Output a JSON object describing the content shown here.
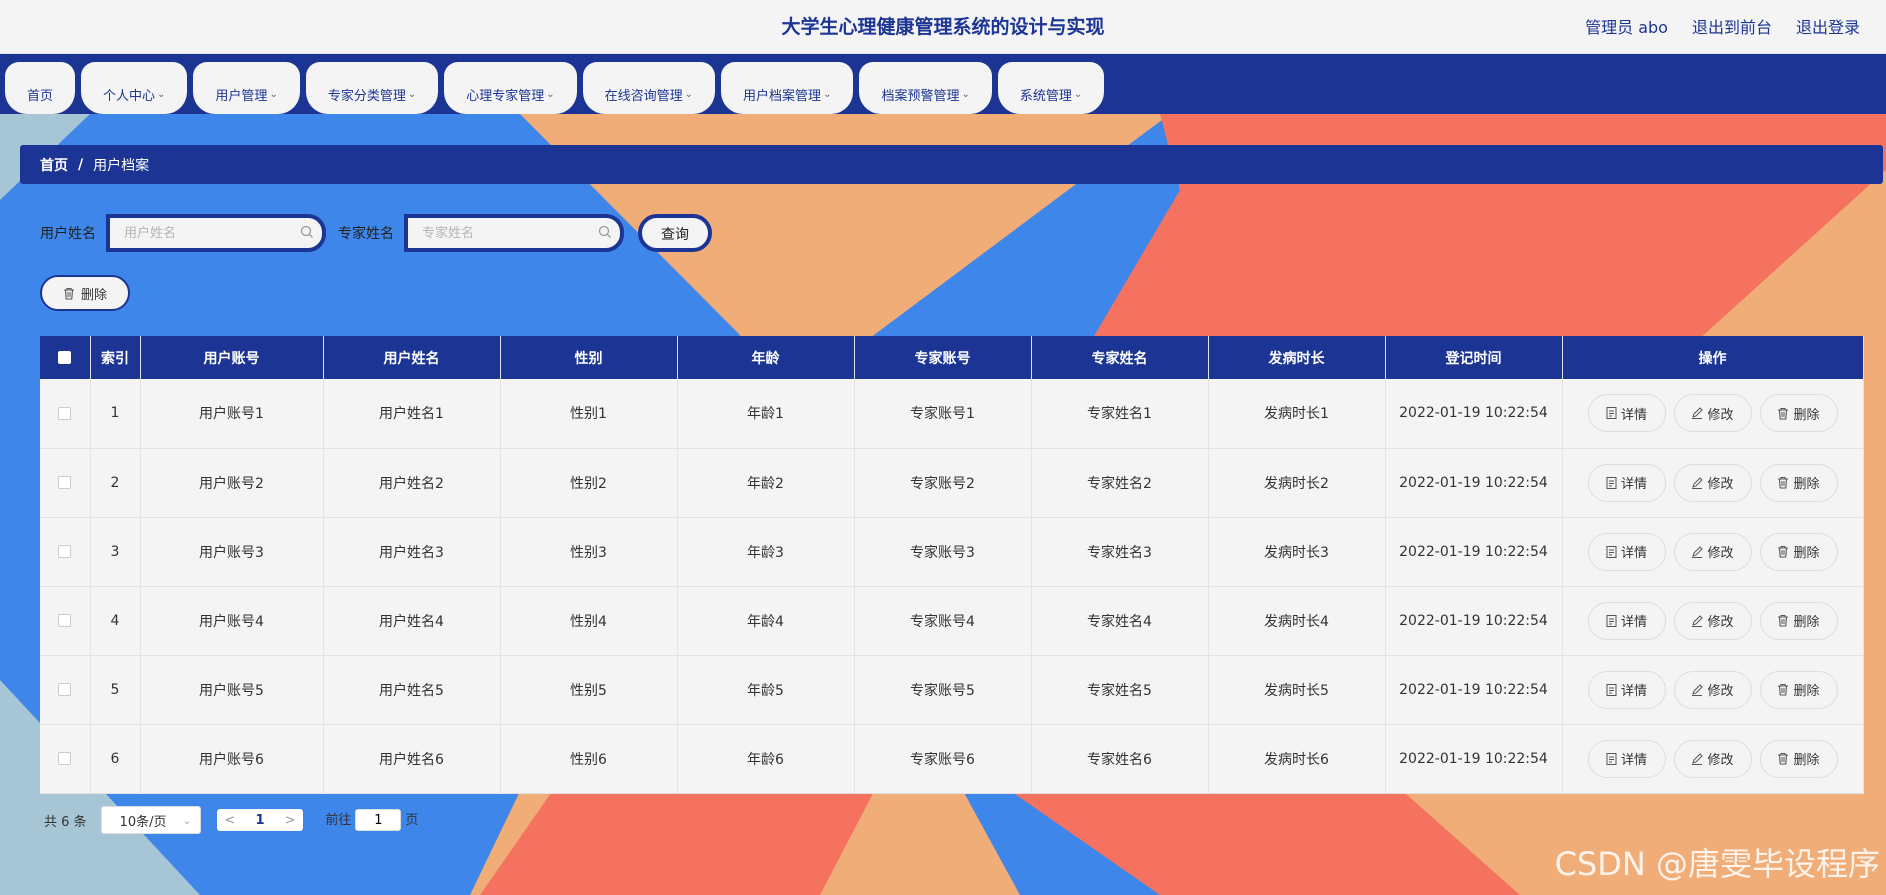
{
  "colors": {
    "primary": "#1c3594",
    "blue": "#3f86ea",
    "salmon": "#f4725f",
    "peach": "#f0ad78",
    "grey_blue": "#a6c6d6"
  },
  "header": {
    "title": "大学生心理健康管理系统的设计与实现",
    "admin": "管理员 abo",
    "to_front": "退出到前台",
    "logout": "退出登录"
  },
  "nav": {
    "items": [
      {
        "label": "首页"
      },
      {
        "label": "个人中心"
      },
      {
        "label": "用户管理"
      },
      {
        "label": "专家分类管理"
      },
      {
        "label": "心理专家管理"
      },
      {
        "label": "在线咨询管理"
      },
      {
        "label": "用户档案管理"
      },
      {
        "label": "档案预警管理"
      },
      {
        "label": "系统管理"
      }
    ]
  },
  "breadcrumb": {
    "home": "首页",
    "sep": "/",
    "current": "用户档案"
  },
  "search": {
    "user_label": "用户姓名",
    "user_placeholder": "用户姓名",
    "expert_label": "专家姓名",
    "expert_placeholder": "专家姓名",
    "query": "查询"
  },
  "toolbar": {
    "delete": "删除"
  },
  "table": {
    "headers": [
      "索引",
      "用户账号",
      "用户姓名",
      "性别",
      "年龄",
      "专家账号",
      "专家姓名",
      "发病时长",
      "登记时间",
      "操作"
    ],
    "rows": [
      {
        "index": "1",
        "account": "用户账号1",
        "name": "用户姓名1",
        "gender": "性别1",
        "age": "年龄1",
        "expert_account": "专家账号1",
        "expert_name": "专家姓名1",
        "duration": "发病时长1",
        "time": "2022-01-19 10:22:54"
      },
      {
        "index": "2",
        "account": "用户账号2",
        "name": "用户姓名2",
        "gender": "性别2",
        "age": "年龄2",
        "expert_account": "专家账号2",
        "expert_name": "专家姓名2",
        "duration": "发病时长2",
        "time": "2022-01-19 10:22:54"
      },
      {
        "index": "3",
        "account": "用户账号3",
        "name": "用户姓名3",
        "gender": "性别3",
        "age": "年龄3",
        "expert_account": "专家账号3",
        "expert_name": "专家姓名3",
        "duration": "发病时长3",
        "time": "2022-01-19 10:22:54"
      },
      {
        "index": "4",
        "account": "用户账号4",
        "name": "用户姓名4",
        "gender": "性别4",
        "age": "年龄4",
        "expert_account": "专家账号4",
        "expert_name": "专家姓名4",
        "duration": "发病时长4",
        "time": "2022-01-19 10:22:54"
      },
      {
        "index": "5",
        "account": "用户账号5",
        "name": "用户姓名5",
        "gender": "性别5",
        "age": "年龄5",
        "expert_account": "专家账号5",
        "expert_name": "专家姓名5",
        "duration": "发病时长5",
        "time": "2022-01-19 10:22:54"
      },
      {
        "index": "6",
        "account": "用户账号6",
        "name": "用户姓名6",
        "gender": "性别6",
        "age": "年龄6",
        "expert_account": "专家账号6",
        "expert_name": "专家姓名6",
        "duration": "发病时长6",
        "time": "2022-01-19 10:22:54"
      }
    ],
    "actions": {
      "detail": "详情",
      "edit": "修改",
      "delete": "删除"
    }
  },
  "pager": {
    "total": "共 6 条",
    "page_size": "10条/页",
    "current_page": "1",
    "goto_prefix": "前往",
    "goto_value": "1",
    "goto_suffix": "页"
  },
  "watermark": "CSDN @唐雯毕设程序"
}
